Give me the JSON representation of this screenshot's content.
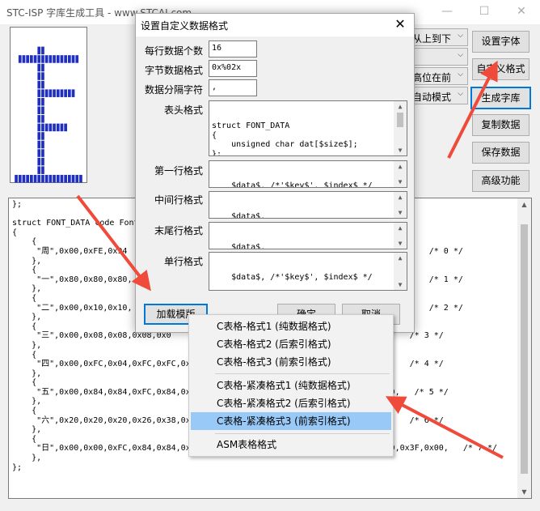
{
  "window": {
    "title": "STC-ISP 字库生成工具 - www.STCAI.com  --"
  },
  "toolbar": {
    "combos": [
      "从上到下",
      "",
      "高位在前",
      "自动模式"
    ],
    "buttons": {
      "set_font": "设置字体",
      "custom_format": "自定义格式",
      "generate": "生成字库",
      "copy": "复制数据",
      "save": "保存数据",
      "advanced": "高级功能"
    }
  },
  "preview": {
    "glyph": "日",
    "pixels": [
      "00000000000000000000",
      "00000000000000000000",
      "00000001100000000000",
      "00111111111111111100",
      "00000001100000000000",
      "00000001100000000000",
      "00000001100000000000",
      "00000001111111111000",
      "00000001100000000000",
      "00000001100000000000",
      "00000001100000000000",
      "00000001111111100000",
      "00000001100000000000",
      "00000001100000000000",
      "00000001100000000000",
      "00000001100000000000",
      "00000001100000000000",
      "01111111111111111110"
    ],
    "on_color": "#1f2fbf",
    "off_color": "#ffffff"
  },
  "code": {
    "lines": [
      "};",
      "",
      "struct FONT_DATA code Font",
      "{",
      "    {",
      "     \"周\",0x00,0xFE,0x94                                                     ,0x00,   /* 0 */",
      "    },",
      "    {",
      "     \"一\",0x80,0x80,0x80,                                                    ,0x00,   /* 1 */",
      "    },",
      "    {",
      "     \"二\",0x00,0x10,0x10,                                                    ,0x00,   /* 2 */",
      "    },",
      "    {",
      "     \"三\",0x00,0x08,0x08,0x08,0x0                                    0x21,0x00,   /* 3 */",
      "    },",
      "    {",
      "     \"四\",0x00,0xFC,0x04,0xFC,0xFC,0x0                               0x7F,0x00,   /* 4 */",
      "    },",
      "    {",
      "     \"五\",0x00,0x84,0x84,0xFC,0x84,0x8                                0x40,0x40,   /* 5 */",
      "    },",
      "    {",
      "     \"六\",0x20,0x20,0x20,0x26,0x38,0x2                               0x38,0x00,   /* 6 */",
      "    },",
      "    {",
      "     \"日\",0x00,0x00,0xFC,0x84,0x84,0x84,0x78,0x00,0x00,0x00,0x3F,0x20,0x20,0x20,0x3F,0x00,   /* 7 */",
      "    },",
      "};"
    ]
  },
  "dialog": {
    "title": "设置自定义数据格式",
    "labels": {
      "per_line": "每行数据个数",
      "byte_format": "字节数据格式",
      "separator": "数据分隔字符",
      "header": "表头格式",
      "first_line": "第一行格式",
      "middle_line": "中间行格式",
      "last_line": "末尾行格式",
      "single_line": "单行格式"
    },
    "values": {
      "per_line": "16",
      "byte_format": "0x%02x",
      "separator": ",",
      "header": "struct FONT_DATA\n{\n    unsigned char dat[$size$];\n};\n\nstruct FONT_DATA code Font_Data[] =",
      "first_line": "    $data$, /*'$key$', $index$ */",
      "middle_line": "    $data$,",
      "last_line": "    $data$,",
      "single_line": "    $data$, /*'$key$', $index$ */"
    },
    "buttons": {
      "load_template": "加载模版",
      "ok": "确定",
      "cancel": "取消"
    }
  },
  "menu": {
    "items": [
      "C表格-格式1 (纯数据格式)",
      "C表格-格式2 (后索引格式)",
      "C表格-格式3 (前索引格式)",
      "C表格-紧凑格式1 (纯数据格式)",
      "C表格-紧凑格式2 (后索引格式)",
      "C表格-紧凑格式3 (前索引格式)",
      "ASM表格格式"
    ],
    "highlighted": 5
  },
  "colors": {
    "accent": "#0078d7",
    "annotation_arrow": "#f04a3a",
    "menu_highlight": "#99c9f7"
  }
}
